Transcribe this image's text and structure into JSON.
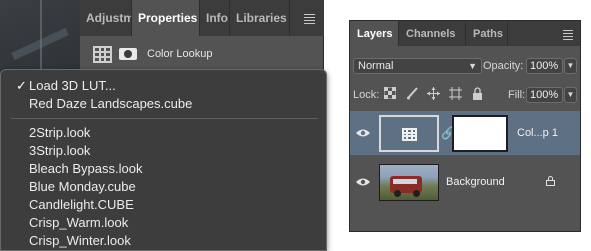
{
  "properties_panel": {
    "tabs": [
      "Adjustm",
      "Properties",
      "Info",
      "Libraries"
    ],
    "active_tab": "Properties",
    "adjustment_label": "Color Lookup"
  },
  "lut_dropdown": {
    "check_mark": "✓",
    "items": [
      "Load 3D LUT...",
      "Red Daze Landscapes.cube",
      "2Strip.look",
      "3Strip.look",
      "Bleach Bypass.look",
      "Blue Monday.cube",
      "Candlelight.CUBE",
      "Crisp_Warm.look",
      "Crisp_Winter.look"
    ],
    "selected": "Load 3D LUT..."
  },
  "layers_panel": {
    "tabs": [
      "Layers",
      "Channels",
      "Paths"
    ],
    "active_tab": "Layers",
    "blend_mode": "Normal",
    "opacity_label": "Opacity:",
    "opacity_value": "100%",
    "lock_label": "Lock:",
    "fill_label": "Fill:",
    "fill_value": "100%",
    "layers": [
      {
        "name": "Col...p 1",
        "visible": true,
        "selected": true
      },
      {
        "name": "Background",
        "visible": true,
        "locked": true
      }
    ]
  },
  "colors": {
    "panel_bg": "#535353",
    "tab_bar_bg": "#3c3c3c",
    "selected_layer": "#5e7084",
    "dropdown_bg": "#3d3d3d"
  }
}
